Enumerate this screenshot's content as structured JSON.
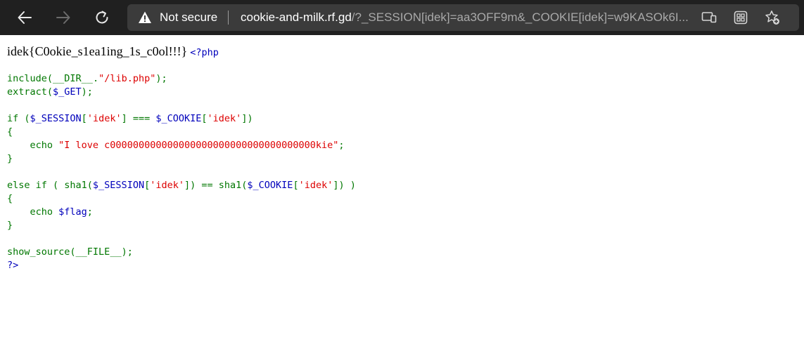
{
  "browser": {
    "security_label": "Not secure",
    "url_host": "cookie-and-milk.rf.gd",
    "url_path": "/?_SESSION[idek]=aa3OFF9m&_COOKIE[idek]=w9KASOk6I...",
    "icons": {
      "back": "arrow-left-icon",
      "forward": "arrow-right-icon",
      "refresh": "refresh-icon",
      "warning": "warning-triangle-icon",
      "read_aloud": "read-aloud-icon",
      "apps": "apps-icon",
      "favorites": "add-favorite-icon"
    },
    "colors": {
      "toolbar_bg": "#202020",
      "address_bg": "#3b3b3b"
    }
  },
  "page": {
    "flag": "idek{C0okie_s1ea1ing_1s_c0ol!!!}",
    "open_tag": "<?php",
    "close_tag": "?>",
    "lines": {
      "include_fn": "include(",
      "include_dir": "__DIR__",
      "include_dot": ".",
      "include_str": "\"/lib.php\"",
      "include_end": ");",
      "extract_fn": "extract(",
      "extract_var": "$_GET",
      "extract_end": ");",
      "if_open": "if (",
      "if_sess": "$_SESSION",
      "if_bracket1": "[",
      "if_key1": "'idek'",
      "if_bracket1_end": "] === ",
      "if_cookie": "$_COOKIE",
      "if_bracket2": "[",
      "if_key2": "'idek'",
      "if_bracket2_end": "])",
      "brace_open": "{",
      "echo1_kw": "    echo ",
      "echo1_str": "\"I love c000000000000000000000000000000000000kie\"",
      "echo1_end": ";",
      "brace_close": "}",
      "elseif_open": "else if ( sha1(",
      "elseif_sess": "$_SESSION",
      "elseif_b1": "[",
      "elseif_key1": "'idek'",
      "elseif_mid": "]) == sha1(",
      "elseif_cookie": "$_COOKIE",
      "elseif_b2": "[",
      "elseif_key2": "'idek'",
      "elseif_end": "]) )",
      "brace_open2": "{",
      "echo2_kw": "    echo ",
      "echo2_var": "$flag",
      "echo2_end": ";",
      "brace_close2": "}",
      "show_fn": "show_source(",
      "show_file": "__FILE__",
      "show_end": ");"
    },
    "syntax_colors": {
      "php_tag": "#0000bb",
      "keyword": "#007700",
      "string": "#dd0000",
      "variable": "#0000bb"
    }
  }
}
